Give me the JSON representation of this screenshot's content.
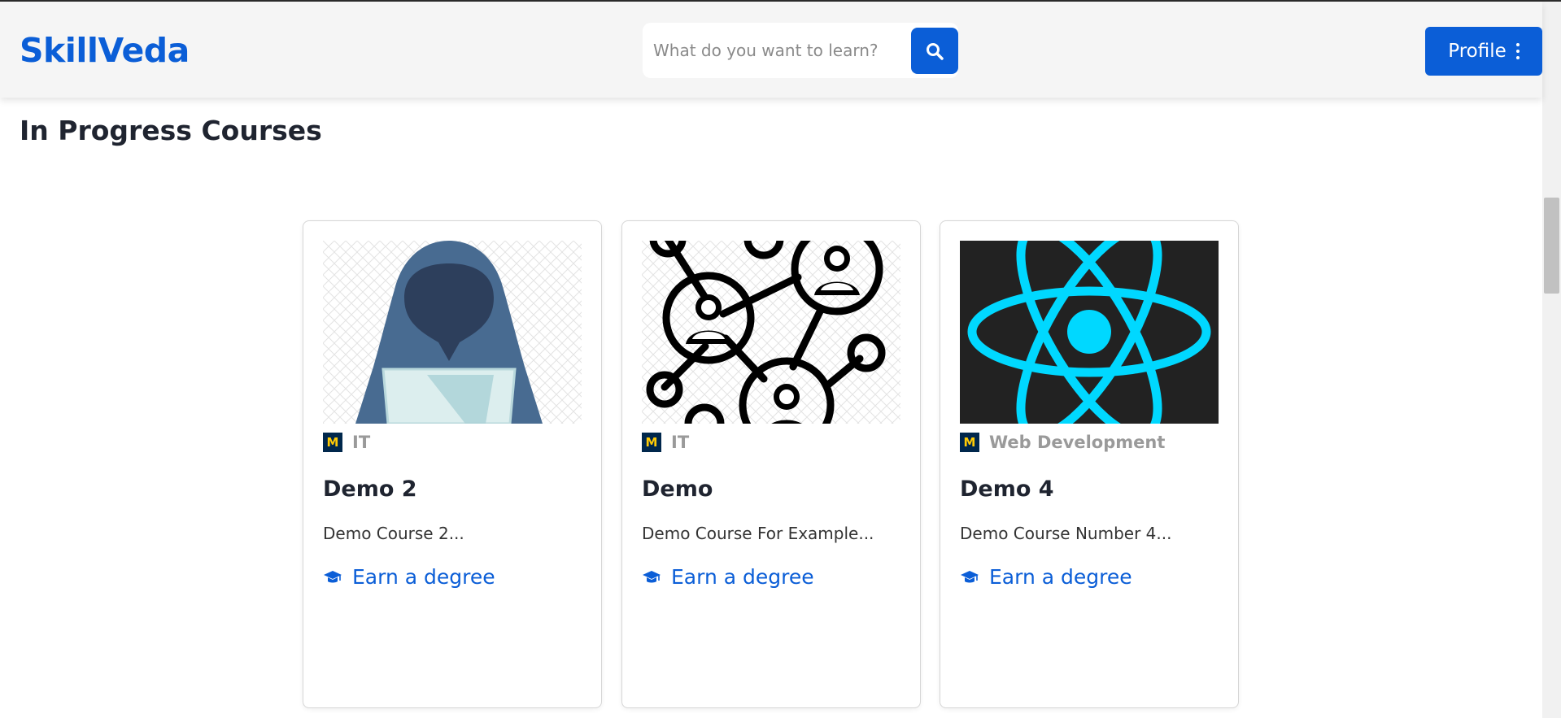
{
  "header": {
    "logo": "SkillVeda",
    "search": {
      "placeholder": "What do you want to learn?",
      "value": ""
    },
    "search_icon": "search-icon",
    "profile_label": "Profile",
    "profile_menu_icon": "kebab-menu-icon"
  },
  "section": {
    "title": "In Progress Courses"
  },
  "courses": [
    {
      "thumbnail_icon": "hacker-icon",
      "university_logo": "M",
      "category": "IT",
      "title": "Demo 2",
      "description": "Demo Course 2...",
      "cta_label": "Earn a degree",
      "cta_icon": "graduation-cap-icon"
    },
    {
      "thumbnail_icon": "network-people-icon",
      "university_logo": "M",
      "category": "IT",
      "title": "Demo",
      "description": "Demo Course For Example...",
      "cta_label": "Earn a degree",
      "cta_icon": "graduation-cap-icon"
    },
    {
      "thumbnail_icon": "react-logo-icon",
      "university_logo": "M",
      "category": "Web Development",
      "title": "Demo 4",
      "description": "Demo Course Number 4...",
      "cta_label": "Earn a degree",
      "cta_icon": "graduation-cap-icon"
    }
  ],
  "colors": {
    "brand": "#0b5ed7",
    "header_bg": "#f5f5f5",
    "category_text": "#9a9a9a",
    "react_bg": "#222222",
    "react_accent": "#00d8ff"
  }
}
